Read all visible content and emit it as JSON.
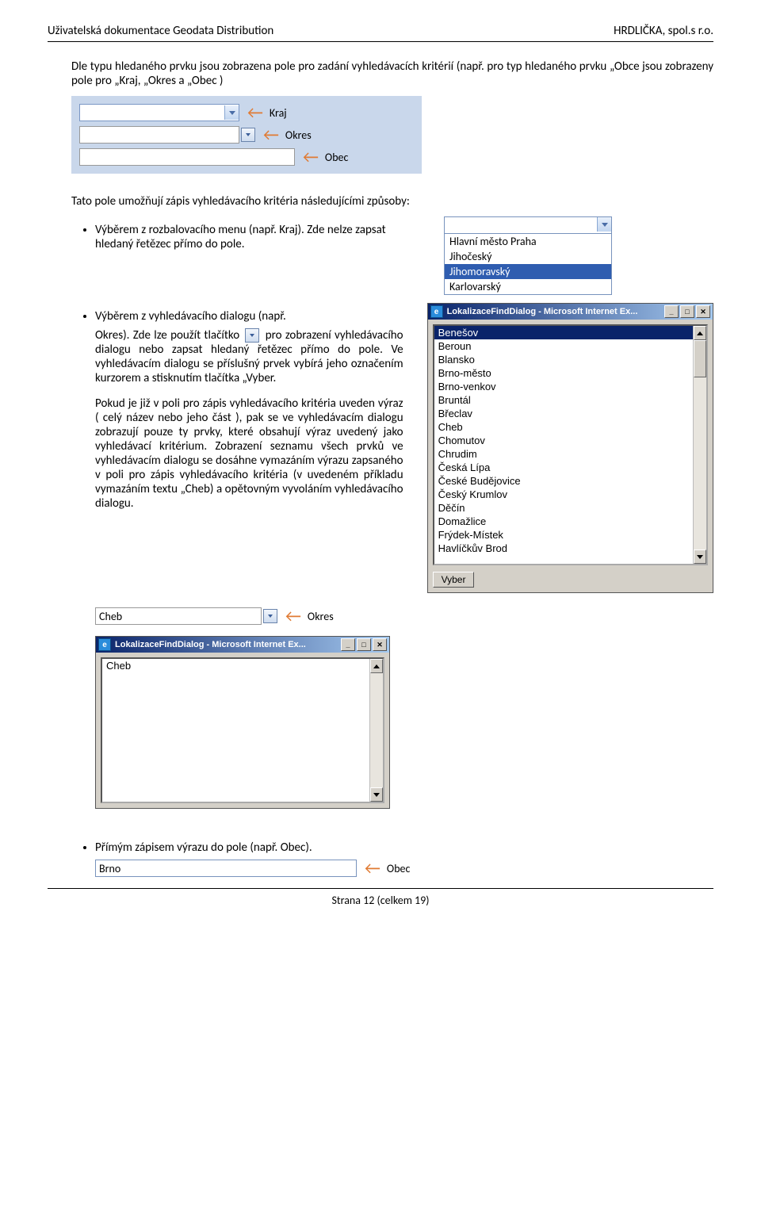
{
  "header": {
    "left": "Uživatelská dokumentace Geodata Distribution",
    "right": "HRDLIČKA, spol.s r.o."
  },
  "intro": "Dle typu hledaného prvku jsou zobrazena pole pro zadání vyhledávacích kritérií (např. pro typ hledaného prvku „Obce jsou zobrazeny pole pro „Kraj, „Okres a „Obec )",
  "kko": {
    "kraj": "Kraj",
    "okres": "Okres",
    "obec": "Obec"
  },
  "after_panel": "Tato pole umožňují zápis vyhledávacího kritéria následujícími způsoby:",
  "bullet1": "Výběrem z rozbalovacího menu (např. Kraj). Zde nelze zapsat hledaný řetězec přímo do pole.",
  "kraj_list": {
    "items": [
      "Hlavní město Praha",
      "Jihočeský",
      "Jihomoravský",
      "Karlovarský"
    ],
    "selected_index": 2
  },
  "bullet2_pre": "Výběrem z vyhledávacího dialogu (např.",
  "bullet2_okres": "Okres). Zde lze použít tlačítko",
  "bullet2_post": "pro zobrazení vyhledávacího dialogu nebo zapsat hledaný řetězec přímo do pole. Ve vyhledávacím dialogu se příslušný prvek vybírá jeho označením kurzorem a stisknutím tlačítka „Vyber.",
  "para2": "Pokud je již v poli pro zápis vyhledávacího kritéria uveden výraz ( celý název nebo jeho část ), pak se ve vyhledávacím dialogu zobrazují pouze ty prvky, které obsahují výraz uvedený jako vyhledávací kritérium. Zobrazení seznamu všech prvků ve vyhledávacím dialogu se dosáhne vymazáním výrazu zapsaného v poli pro zápis vyhledávacího kritéria (v uvedeném příkladu vymazáním textu „Cheb) a opětovným vyvoláním vyhledávacího dialogu.",
  "dialog": {
    "title": "LokalizaceFindDialog - Microsoft Internet Ex...",
    "items": [
      "Benešov",
      "Beroun",
      "Blansko",
      "Brno-město",
      "Brno-venkov",
      "Bruntál",
      "Břeclav",
      "Cheb",
      "Chomutov",
      "Chrudim",
      "Česká Lípa",
      "České Budějovice",
      "Český Krumlov",
      "Děčín",
      "Domažlice",
      "Frýdek-Místek",
      "Havlíčkův Brod"
    ],
    "selected_index": 0,
    "button": "Vyber"
  },
  "cheb": {
    "value": "Cheb",
    "label": "Okres"
  },
  "dialog2": {
    "title": "LokalizaceFindDialog - Microsoft Internet Ex...",
    "value": "Cheb"
  },
  "bullet3": "Přímým zápisem výrazu do pole (např. Obec).",
  "brno": {
    "value": "Brno",
    "label": "Obec"
  },
  "footer": "Strana 12 (celkem 19)"
}
